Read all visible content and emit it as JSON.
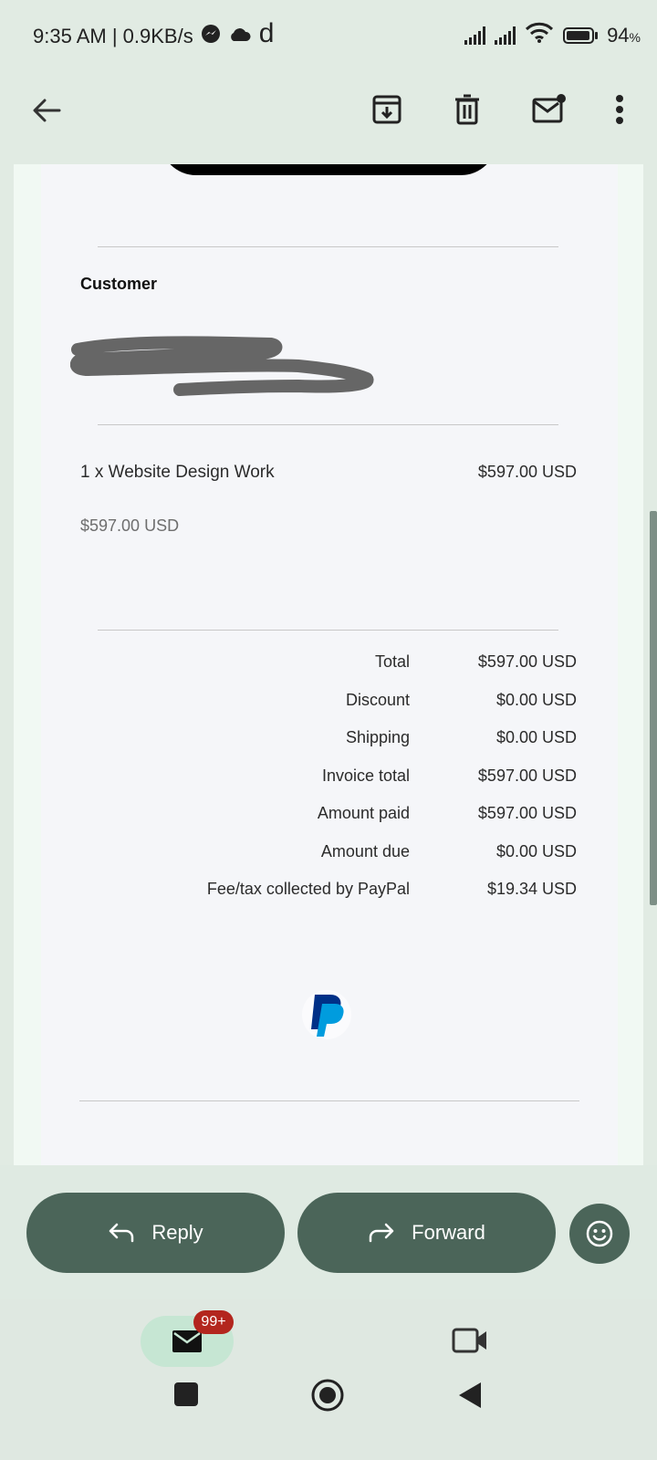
{
  "status_bar": {
    "time_speed": "9:35 AM | 0.9KB/s",
    "extra_glyph": "d",
    "battery": "94",
    "battery_unit": "%"
  },
  "invoice": {
    "customer_heading": "Customer",
    "line_item": {
      "description": "1 x Website Design Work",
      "amount": "$597.00 USD",
      "unit_price": "$597.00 USD"
    },
    "summary": [
      {
        "label": "Total",
        "value": "$597.00 USD"
      },
      {
        "label": "Discount",
        "value": "$0.00 USD"
      },
      {
        "label": "Shipping",
        "value": "$0.00 USD"
      },
      {
        "label": "Invoice total",
        "value": "$597.00 USD"
      },
      {
        "label": "Amount paid",
        "value": "$597.00 USD"
      },
      {
        "label": "Amount due",
        "value": "$0.00 USD"
      },
      {
        "label": "Fee/tax collected by PayPal",
        "value": "$19.34 USD"
      }
    ]
  },
  "actions": {
    "reply_label": "Reply",
    "forward_label": "Forward"
  },
  "bottom_nav": {
    "mail_badge": "99+"
  },
  "colors": {
    "pill_green": "#4b6559",
    "badge_red": "#b3261e",
    "paypal_dark": "#003087",
    "paypal_light": "#009cde"
  }
}
